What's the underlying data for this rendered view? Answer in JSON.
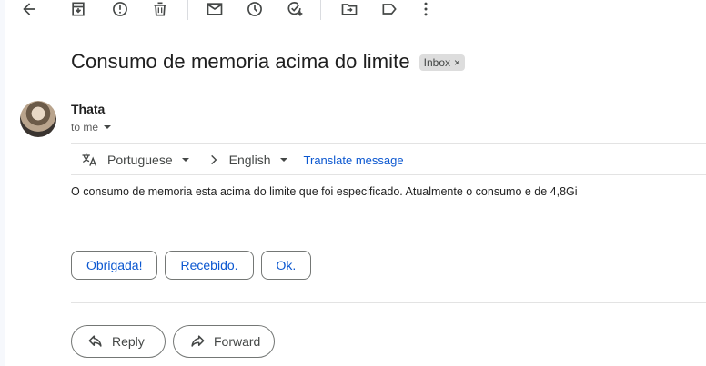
{
  "toolbar": {
    "icons": [
      "back-arrow-icon",
      "archive-icon",
      "report-spam-icon",
      "delete-icon",
      "mark-unread-icon",
      "snooze-icon",
      "add-task-icon",
      "move-to-icon",
      "label-icon",
      "more-vert-icon"
    ]
  },
  "message": {
    "subject": "Consumo de memoria acima do limite",
    "label": "Inbox",
    "sender_name": "Thata",
    "recipient": "to me",
    "body": "O consumo de memoria esta acima do limite que foi especificado. Atualmente o consumo e de 4,8Gi"
  },
  "translate": {
    "from_language": "Portuguese",
    "to_language": "English",
    "link_label": "Translate message"
  },
  "smart_replies": [
    "Obrigada!",
    "Recebido.",
    "Ok."
  ],
  "actions": {
    "reply_label": "Reply",
    "forward_label": "Forward"
  },
  "colors": {
    "link_blue": "#0b57d0",
    "chip_border": "#747775",
    "label_bg": "#dddddd"
  }
}
